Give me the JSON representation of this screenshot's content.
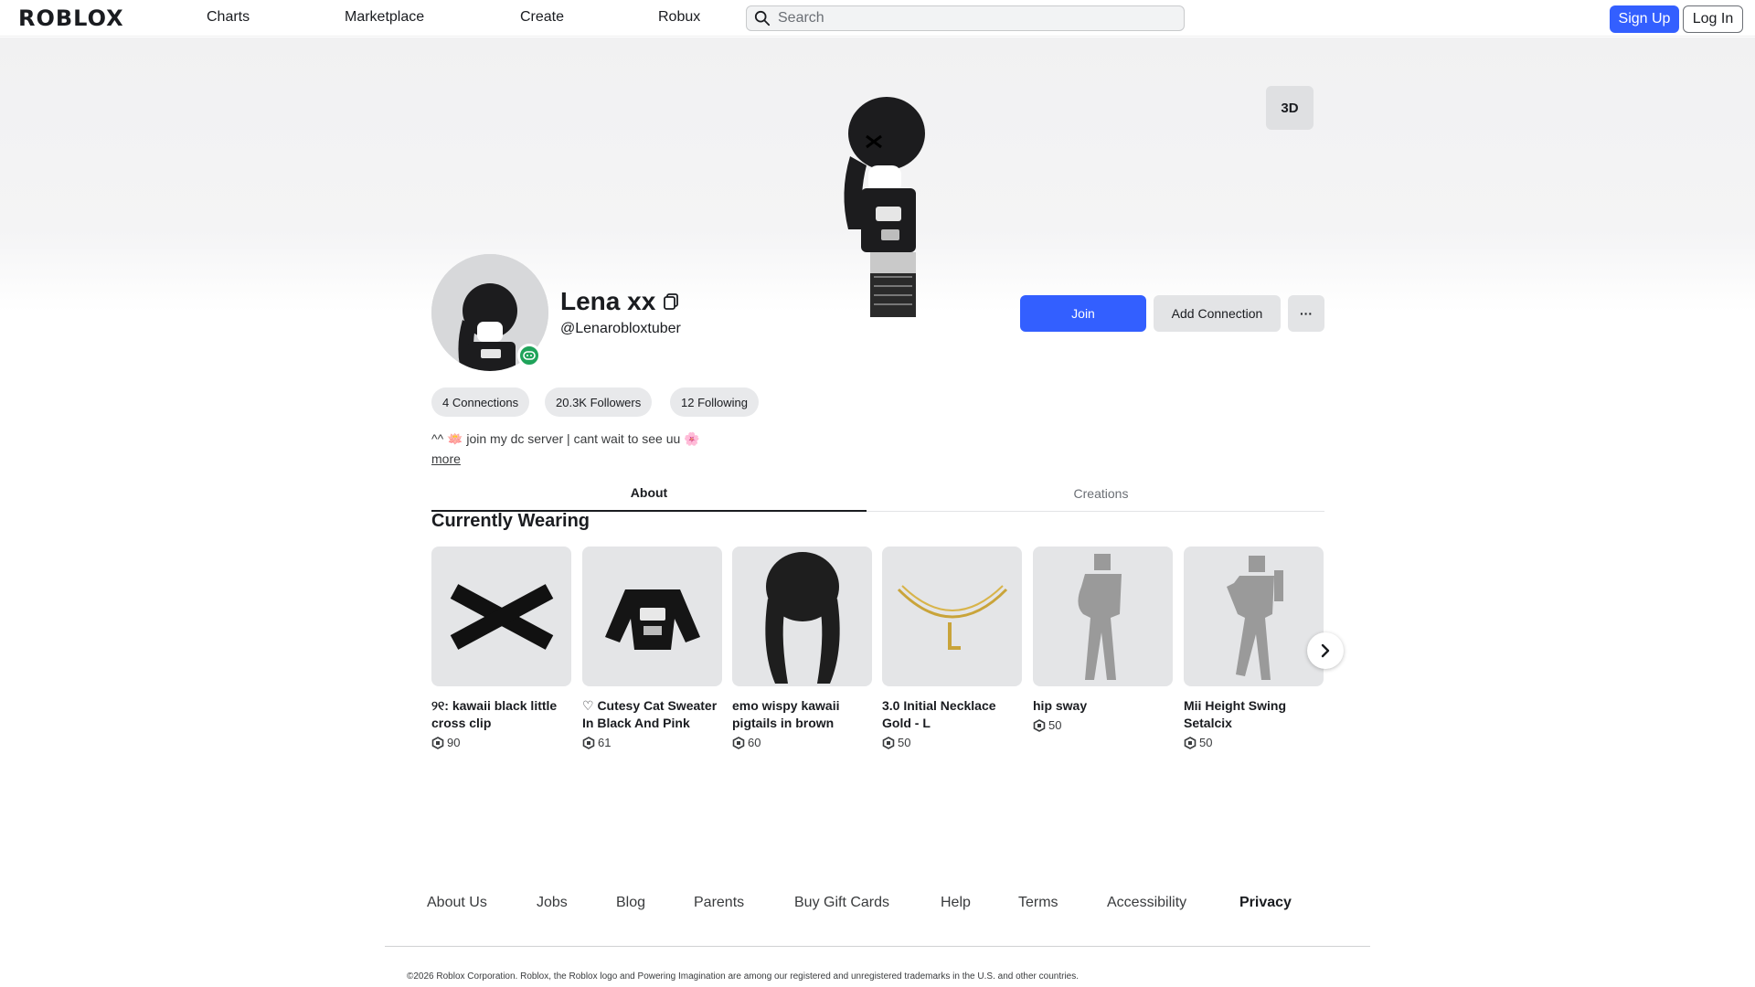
{
  "nav": {
    "logo": "ROBLOX",
    "links": [
      "Charts",
      "Marketplace",
      "Create",
      "Robux"
    ],
    "search_placeholder": "Search",
    "signup": "Sign Up",
    "login": "Log In"
  },
  "hero": {
    "view_toggle": "3D"
  },
  "profile": {
    "display_name": "Lena xx",
    "username": "@Lenarobloxtuber",
    "join_label": "Join",
    "add_connection_label": "Add Connection",
    "more_label": "···",
    "stats": {
      "connections": "4 Connections",
      "followers": "20.3K Followers",
      "following": "12 Following"
    },
    "bio": "^^ 🪷 join my dc server | cant wait to see uu 🌸",
    "bio_more": "more"
  },
  "tabs": {
    "about": "About",
    "creations": "Creations"
  },
  "wearing": {
    "title": "Currently Wearing",
    "items": [
      {
        "name": "୨୧: kawaii black little cross clip",
        "price": "90",
        "icon": "cross-clip-icon"
      },
      {
        "name": "♡ Cutesy Cat Sweater In Black And Pink",
        "price": "61",
        "icon": "sweater-icon"
      },
      {
        "name": "emo wispy kawaii pigtails in brown",
        "price": "60",
        "icon": "hair-icon"
      },
      {
        "name": "3.0 Initial Necklace Gold - L",
        "price": "50",
        "icon": "necklace-icon"
      },
      {
        "name": "hip sway",
        "price": "50",
        "icon": "emote-figure-icon"
      },
      {
        "name": "Mii Height Swing Setalcix",
        "price": "50",
        "icon": "emote-figure-icon"
      }
    ]
  },
  "footer": {
    "links": [
      "About Us",
      "Jobs",
      "Blog",
      "Parents",
      "Buy Gift Cards",
      "Help",
      "Terms",
      "Accessibility",
      "Privacy"
    ],
    "copyright": "©2026 Roblox Corporation. Roblox, the Roblox logo and Powering Imagination are among our registered and unregistered trademarks in the U.S. and other countries."
  },
  "colors": {
    "primary_blue": "#335fff",
    "online_green": "#1fa35a",
    "pill_bg": "#e8e9eb"
  }
}
